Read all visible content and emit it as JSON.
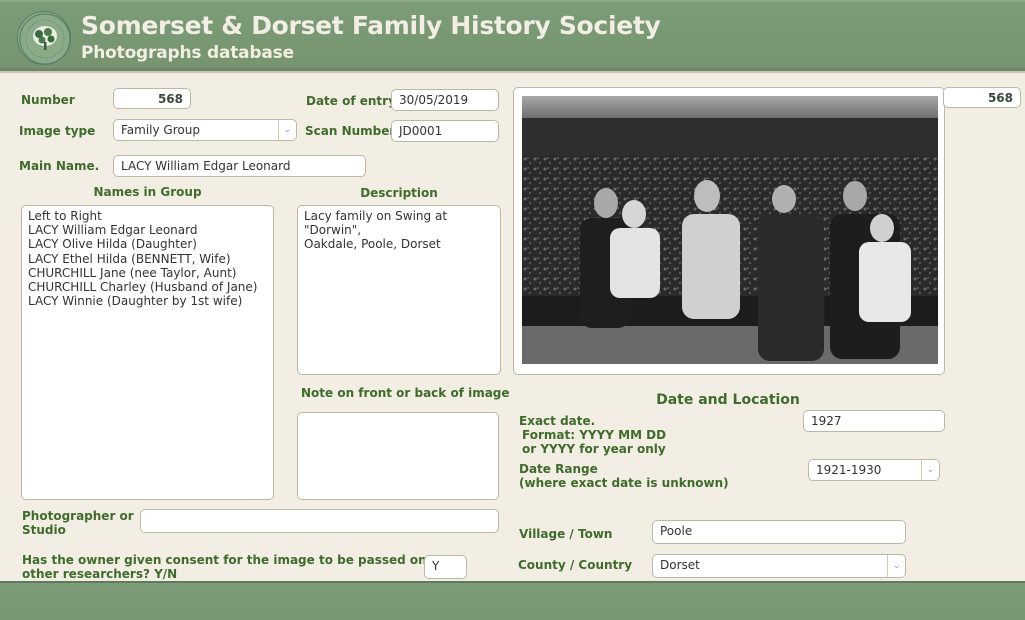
{
  "header": {
    "title": "Somerset & Dorset Family History Society",
    "subtitle": "Photographs database",
    "logo_icon": "society-tree-logo"
  },
  "form": {
    "number": {
      "label": "Number",
      "value": "568"
    },
    "date_of_entry": {
      "label": "Date of entry",
      "value": "30/05/2019"
    },
    "image_type": {
      "label": "Image type",
      "value": "Family Group"
    },
    "scan_number": {
      "label": "Scan Number",
      "value": "JD0001"
    },
    "main_name": {
      "label": "Main Name.",
      "value": "LACY William Edgar Leonard"
    },
    "names_in_group": {
      "label": "Names in Group",
      "value": "Left to Right\nLACY William Edgar Leonard\nLACY Olive Hilda (Daughter)\nLACY Ethel Hilda (BENNETT, Wife)\nCHURCHILL Jane (nee Taylor, Aunt)\nCHURCHILL Charley (Husband of Jane)\nLACY Winnie (Daughter by 1st wife)"
    },
    "description": {
      "label": "Description",
      "value": "Lacy family on Swing at \"Dorwin\",\nOakdale, Poole, Dorset"
    },
    "note": {
      "label": "Note on front or back of image",
      "value": ""
    },
    "photographer": {
      "label_line1": "Photographer or",
      "label_line2": "Studio",
      "value": ""
    },
    "consent": {
      "label_line1": "Has the owner given consent for the image to be passed on to",
      "label_line2": "other researchers? Y/N",
      "value": "Y"
    },
    "record_number_display": "568"
  },
  "date_location": {
    "heading": "Date and Location",
    "exact_date": {
      "label": "Exact date.",
      "format_line1": "Format: YYYY MM DD",
      "format_line2": "or YYYY for year only",
      "value": "1927"
    },
    "date_range": {
      "label": "Date Range",
      "sublabel": "(where exact date is unknown)",
      "value": "1921-1930"
    },
    "village": {
      "label": "Village / Town",
      "value": "Poole"
    },
    "county": {
      "label": "County / Country",
      "value": "Dorset"
    }
  },
  "photo": {
    "description": "Black and white family group photograph of six people seated on a garden swing"
  },
  "icons": {
    "dropdown": "chevron-down"
  }
}
